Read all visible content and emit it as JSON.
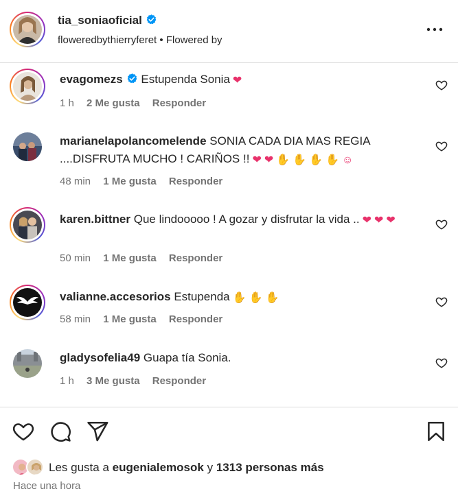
{
  "post": {
    "username": "tia_soniaoficial",
    "subtitle_account": "floweredbythierryferet",
    "subtitle_sep": "•",
    "subtitle_text": "Flowered by"
  },
  "comments": [
    {
      "username": "evagomezs",
      "verified": true,
      "text": "Estupenda Sonia",
      "emojis": [
        "heart"
      ],
      "time": "1 h",
      "likes": "2 Me gusta",
      "reply": "Responder"
    },
    {
      "username": "marianelapolancomelende",
      "verified": false,
      "text": "SONIA CADA DIA MAS REGIA ....DISFRUTA MUCHO ! CARIÑOS !!",
      "emojis": [
        "heart",
        "heart",
        "clap",
        "clap",
        "clap",
        "clap",
        "heart-eyes"
      ],
      "time": "48 min",
      "likes": "1 Me gusta",
      "reply": "Responder"
    },
    {
      "username": "karen.bittner",
      "verified": false,
      "text": "Que lindooooo ! A gozar y disfrutar la vida ..",
      "emojis": [
        "heart",
        "heart",
        "heart"
      ],
      "time": "50 min",
      "likes": "1 Me gusta",
      "reply": "Responder"
    },
    {
      "username": "valianne.accesorios",
      "verified": false,
      "text": "Estupenda",
      "emojis": [
        "clap",
        "clap",
        "clap"
      ],
      "time": "58 min",
      "likes": "1 Me gusta",
      "reply": "Responder"
    },
    {
      "username": "gladysofelia49",
      "verified": false,
      "text": "Guapa tía Sonia.",
      "emojis": [],
      "time": "1 h",
      "likes": "3 Me gusta",
      "reply": "Responder"
    }
  ],
  "footer": {
    "likes_prefix": "Les gusta a",
    "likes_user": "eugenialemosok",
    "likes_join": "y",
    "likes_others": "1313 personas más",
    "timestamp": "Hace una hora"
  },
  "icons": {
    "more": "more-horizontal-icon",
    "like": "heart-outline-icon",
    "comment": "comment-bubble-icon",
    "share": "paper-plane-icon",
    "save": "bookmark-icon",
    "verified": "verified-badge-icon"
  },
  "colors": {
    "verified": "#0095f6",
    "text": "#262626",
    "muted": "#737373",
    "divider": "#dbdbdb",
    "emoji_heart": "#e8326b",
    "emoji_clap": "#f0b42a"
  }
}
